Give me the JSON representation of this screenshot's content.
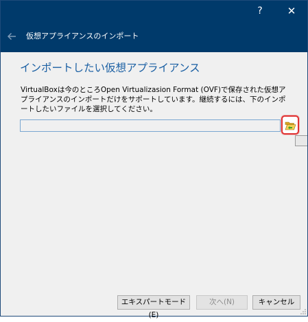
{
  "window": {
    "help_glyph": "?",
    "close_glyph": "✕"
  },
  "nav": {
    "title": "仮想アプライアンスのインポート",
    "back_icon": "arrow-left-icon"
  },
  "main": {
    "heading": "インポートしたい仮想アプライアンス",
    "description": "VirtualBoxは今のところOpen Virtualizasion Format (OVF)で保存された仮想アプライアンスのインポートだけをサポートしています。継続するには、下のインポートしたいファイルを選択してください。",
    "file_input": {
      "value": "",
      "placeholder": ""
    },
    "browse_icon": "folder-open-icon",
    "highlight_color": "#e03030"
  },
  "footer": {
    "expert_label": "エキスパートモード(E)",
    "next_label": "次へ(N)",
    "cancel_label": "キャンセル"
  },
  "colors": {
    "titlebar": "#003a6b",
    "heading": "#1a5fa3",
    "background": "#f0f0f0"
  }
}
